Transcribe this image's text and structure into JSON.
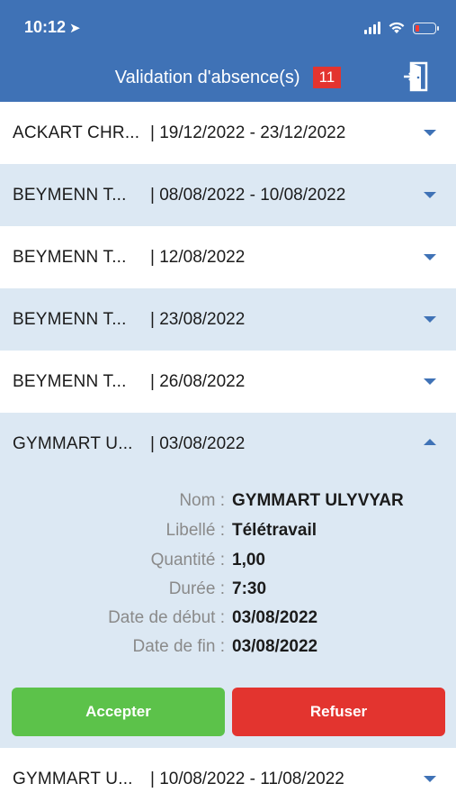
{
  "status_bar": {
    "time": "10:12"
  },
  "header": {
    "title": "Validation d'absence(s)",
    "badge_count": "11"
  },
  "rows_top": [
    {
      "name": "ACKART CHR...",
      "dates": "| 19/12/2022 - 23/12/2022"
    },
    {
      "name": "BEYMENN T...",
      "dates": "| 08/08/2022 - 10/08/2022"
    },
    {
      "name": "BEYMENN T...",
      "dates": "| 12/08/2022"
    },
    {
      "name": "BEYMENN T...",
      "dates": "| 23/08/2022"
    },
    {
      "name": "BEYMENN T...",
      "dates": "| 26/08/2022"
    },
    {
      "name": "GYMMART U...",
      "dates": "| 03/08/2022"
    }
  ],
  "detail": {
    "fields": [
      {
        "label": "Nom :",
        "value": "GYMMART ULYVYAR"
      },
      {
        "label": "Libellé :",
        "value": "Télétravail"
      },
      {
        "label": "Quantité :",
        "value": "1,00"
      },
      {
        "label": "Durée :",
        "value": "7:30"
      },
      {
        "label": "Date de début :",
        "value": "03/08/2022"
      },
      {
        "label": "Date de fin :",
        "value": "03/08/2022"
      }
    ],
    "accept_label": "Accepter",
    "refuse_label": "Refuser"
  },
  "rows_bottom": [
    {
      "name": "GYMMART U...",
      "dates": "| 10/08/2022 - 11/08/2022"
    }
  ],
  "colors": {
    "header": "#3f72b6",
    "row_alt": "#dce8f3",
    "accept": "#5cc24a",
    "refuse": "#e3342f",
    "badge": "#e3342f"
  }
}
